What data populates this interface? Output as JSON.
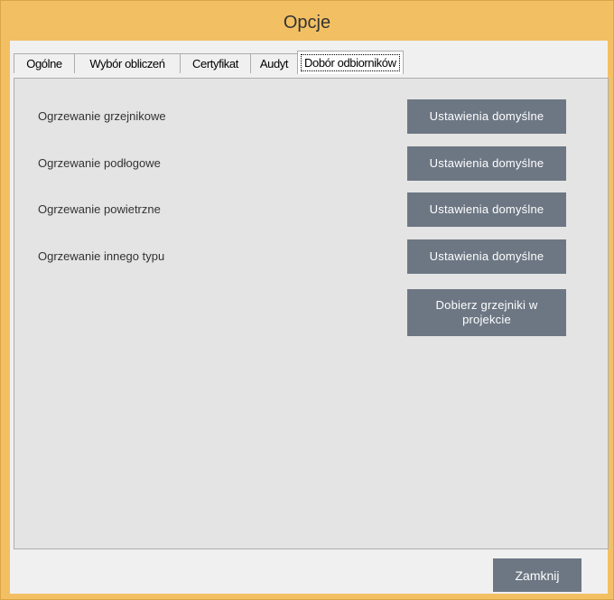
{
  "window": {
    "title": "Opcje"
  },
  "tabs": [
    {
      "label": "Ogólne",
      "active": false
    },
    {
      "label": "Wybór obliczeń",
      "active": false
    },
    {
      "label": "Certyfikat",
      "active": false
    },
    {
      "label": "Audyt",
      "active": false
    },
    {
      "label": "Dobór odbiorników",
      "active": true
    }
  ],
  "rows": [
    {
      "label": "Ogrzewanie grzejnikowe",
      "button": "Ustawienia domyślne"
    },
    {
      "label": "Ogrzewanie podłogowe",
      "button": "Ustawienia domyślne"
    },
    {
      "label": "Ogrzewanie powietrzne",
      "button": "Ustawienia domyślne"
    },
    {
      "label": "Ogrzewanie innego typu",
      "button": "Ustawienia domyślne"
    }
  ],
  "select_button": "Dobierz grzejniki w projekcie",
  "footer": {
    "close_label": "Zamknij"
  }
}
